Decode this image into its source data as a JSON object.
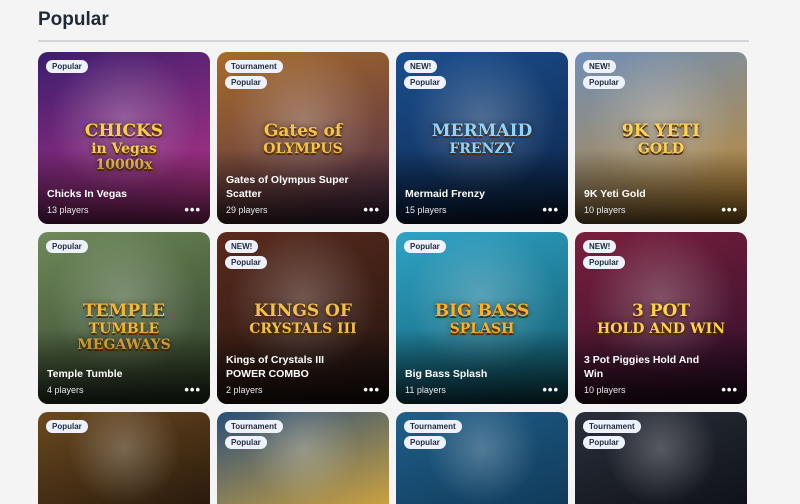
{
  "section": {
    "title": "Popular"
  },
  "cards": [
    {
      "name": "Chicks In Vegas",
      "players": "13 players",
      "badges": [
        "Popular"
      ],
      "more": "•••",
      "logo": [
        "CHICKS",
        "in Vegas",
        "10000x"
      ],
      "bg": [
        "#3b1d6e",
        "#c0368a"
      ],
      "logo_color": "#f7d046"
    },
    {
      "name": "Gates of Olympus Super Scatter",
      "players": "29 players",
      "badges": [
        "Tournament",
        "Popular"
      ],
      "more": "•••",
      "logo": [
        "Gates of",
        "OLYMPUS"
      ],
      "bg": [
        "#a86b2a",
        "#4a2a4a"
      ],
      "logo_color": "#f5c542"
    },
    {
      "name": "Mermaid Frenzy",
      "players": "15 players",
      "badges": [
        "NEW!",
        "Popular"
      ],
      "more": "•••",
      "logo": [
        "MERMAID",
        "FRENZY"
      ],
      "bg": [
        "#1b4f8f",
        "#0b2346"
      ],
      "logo_color": "#8fd3ff"
    },
    {
      "name": "9K Yeti Gold",
      "players": "10 players",
      "badges": [
        "NEW!",
        "Popular"
      ],
      "more": "•••",
      "logo": [
        "9K YETI",
        "GOLD"
      ],
      "bg": [
        "#6f8fb8",
        "#c78a2a"
      ],
      "logo_color": "#ffd34d"
    },
    {
      "name": "Temple Tumble",
      "players": "4 players",
      "badges": [
        "Popular"
      ],
      "more": "•••",
      "logo": [
        "TEMPLE",
        "TUMBLE",
        "MEGAWAYS"
      ],
      "bg": [
        "#6f8a5a",
        "#2c3b26"
      ],
      "logo_color": "#f0b83a"
    },
    {
      "name": "Kings of Crystals III POWER COMBO",
      "players": "2 players",
      "badges": [
        "NEW!",
        "Popular"
      ],
      "more": "•••",
      "logo": [
        "KINGS OF",
        "CRYSTALS III"
      ],
      "bg": [
        "#5b2a1c",
        "#1f1410"
      ],
      "logo_color": "#f3c04a"
    },
    {
      "name": "Big Bass Splash",
      "players": "11 players",
      "badges": [
        "Popular"
      ],
      "more": "•••",
      "logo": [
        "BIG BASS",
        "SPLASH"
      ],
      "bg": [
        "#2fa4c7",
        "#0f5566"
      ],
      "logo_color": "#ffb020"
    },
    {
      "name": "3 Pot Piggies Hold And Win",
      "players": "10 players",
      "badges": [
        "NEW!",
        "Popular"
      ],
      "more": "•••",
      "logo": [
        "3 POT",
        "HOLD AND WIN"
      ],
      "bg": [
        "#7a1f3d",
        "#2b0f2a"
      ],
      "logo_color": "#ffd24a"
    },
    {
      "name": "",
      "players": "",
      "badges": [
        "Popular"
      ],
      "more": "",
      "logo": [],
      "bg": [
        "#6b4a1f",
        "#2a1a0c"
      ],
      "logo_color": "#f0c050"
    },
    {
      "name": "",
      "players": "",
      "badges": [
        "Tournament",
        "Popular"
      ],
      "more": "",
      "logo": [],
      "bg": [
        "#2a4f7a",
        "#c9a040"
      ],
      "logo_color": "#f0c050"
    },
    {
      "name": "",
      "players": "",
      "badges": [
        "Tournament",
        "Popular"
      ],
      "more": "",
      "logo": [],
      "bg": [
        "#1f5f8a",
        "#103a5a"
      ],
      "logo_color": "#f0c050"
    },
    {
      "name": "",
      "players": "",
      "badges": [
        "Tournament",
        "Popular"
      ],
      "more": "",
      "logo": [],
      "bg": [
        "#2a2f3a",
        "#0f1218"
      ],
      "logo_color": "#f0c050"
    }
  ]
}
